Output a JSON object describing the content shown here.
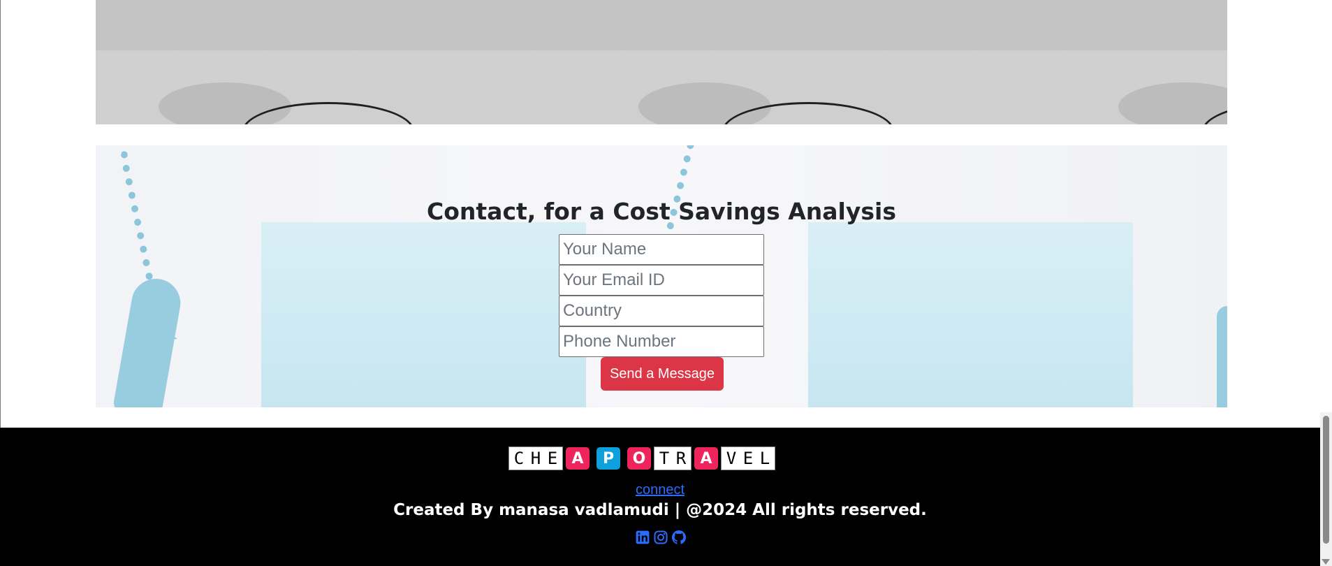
{
  "contact": {
    "title": "Contact, for a Cost Savings Analysis",
    "fields": {
      "name_placeholder": "Your Name",
      "email_placeholder": "Your Email ID",
      "country_placeholder": "Country",
      "phone_placeholder": "Phone Number"
    },
    "submit_label": "Send a Message"
  },
  "footer": {
    "logo": {
      "left_letters": [
        "C",
        "H",
        "E"
      ],
      "badges": [
        {
          "letter": "A",
          "color": "#f0245c"
        },
        {
          "letter": "P",
          "color": "#0ea0dc"
        },
        {
          "letter": "O",
          "color": "#f0245c"
        }
      ],
      "middle_letters": [
        "T",
        "R"
      ],
      "badge2": {
        "letter": "A",
        "color": "#f0245c"
      },
      "right_letters": [
        "V",
        "E",
        "L"
      ]
    },
    "connect_label": "connect",
    "credits": "Created By manasa vadlamudi | @2024 All rights reserved.",
    "social_icons": [
      "linkedin-icon",
      "instagram-icon",
      "github-icon"
    ],
    "link_color": "#2b6cff"
  },
  "colors": {
    "submit_button": "#dc3545",
    "footer_background": "#000000"
  }
}
